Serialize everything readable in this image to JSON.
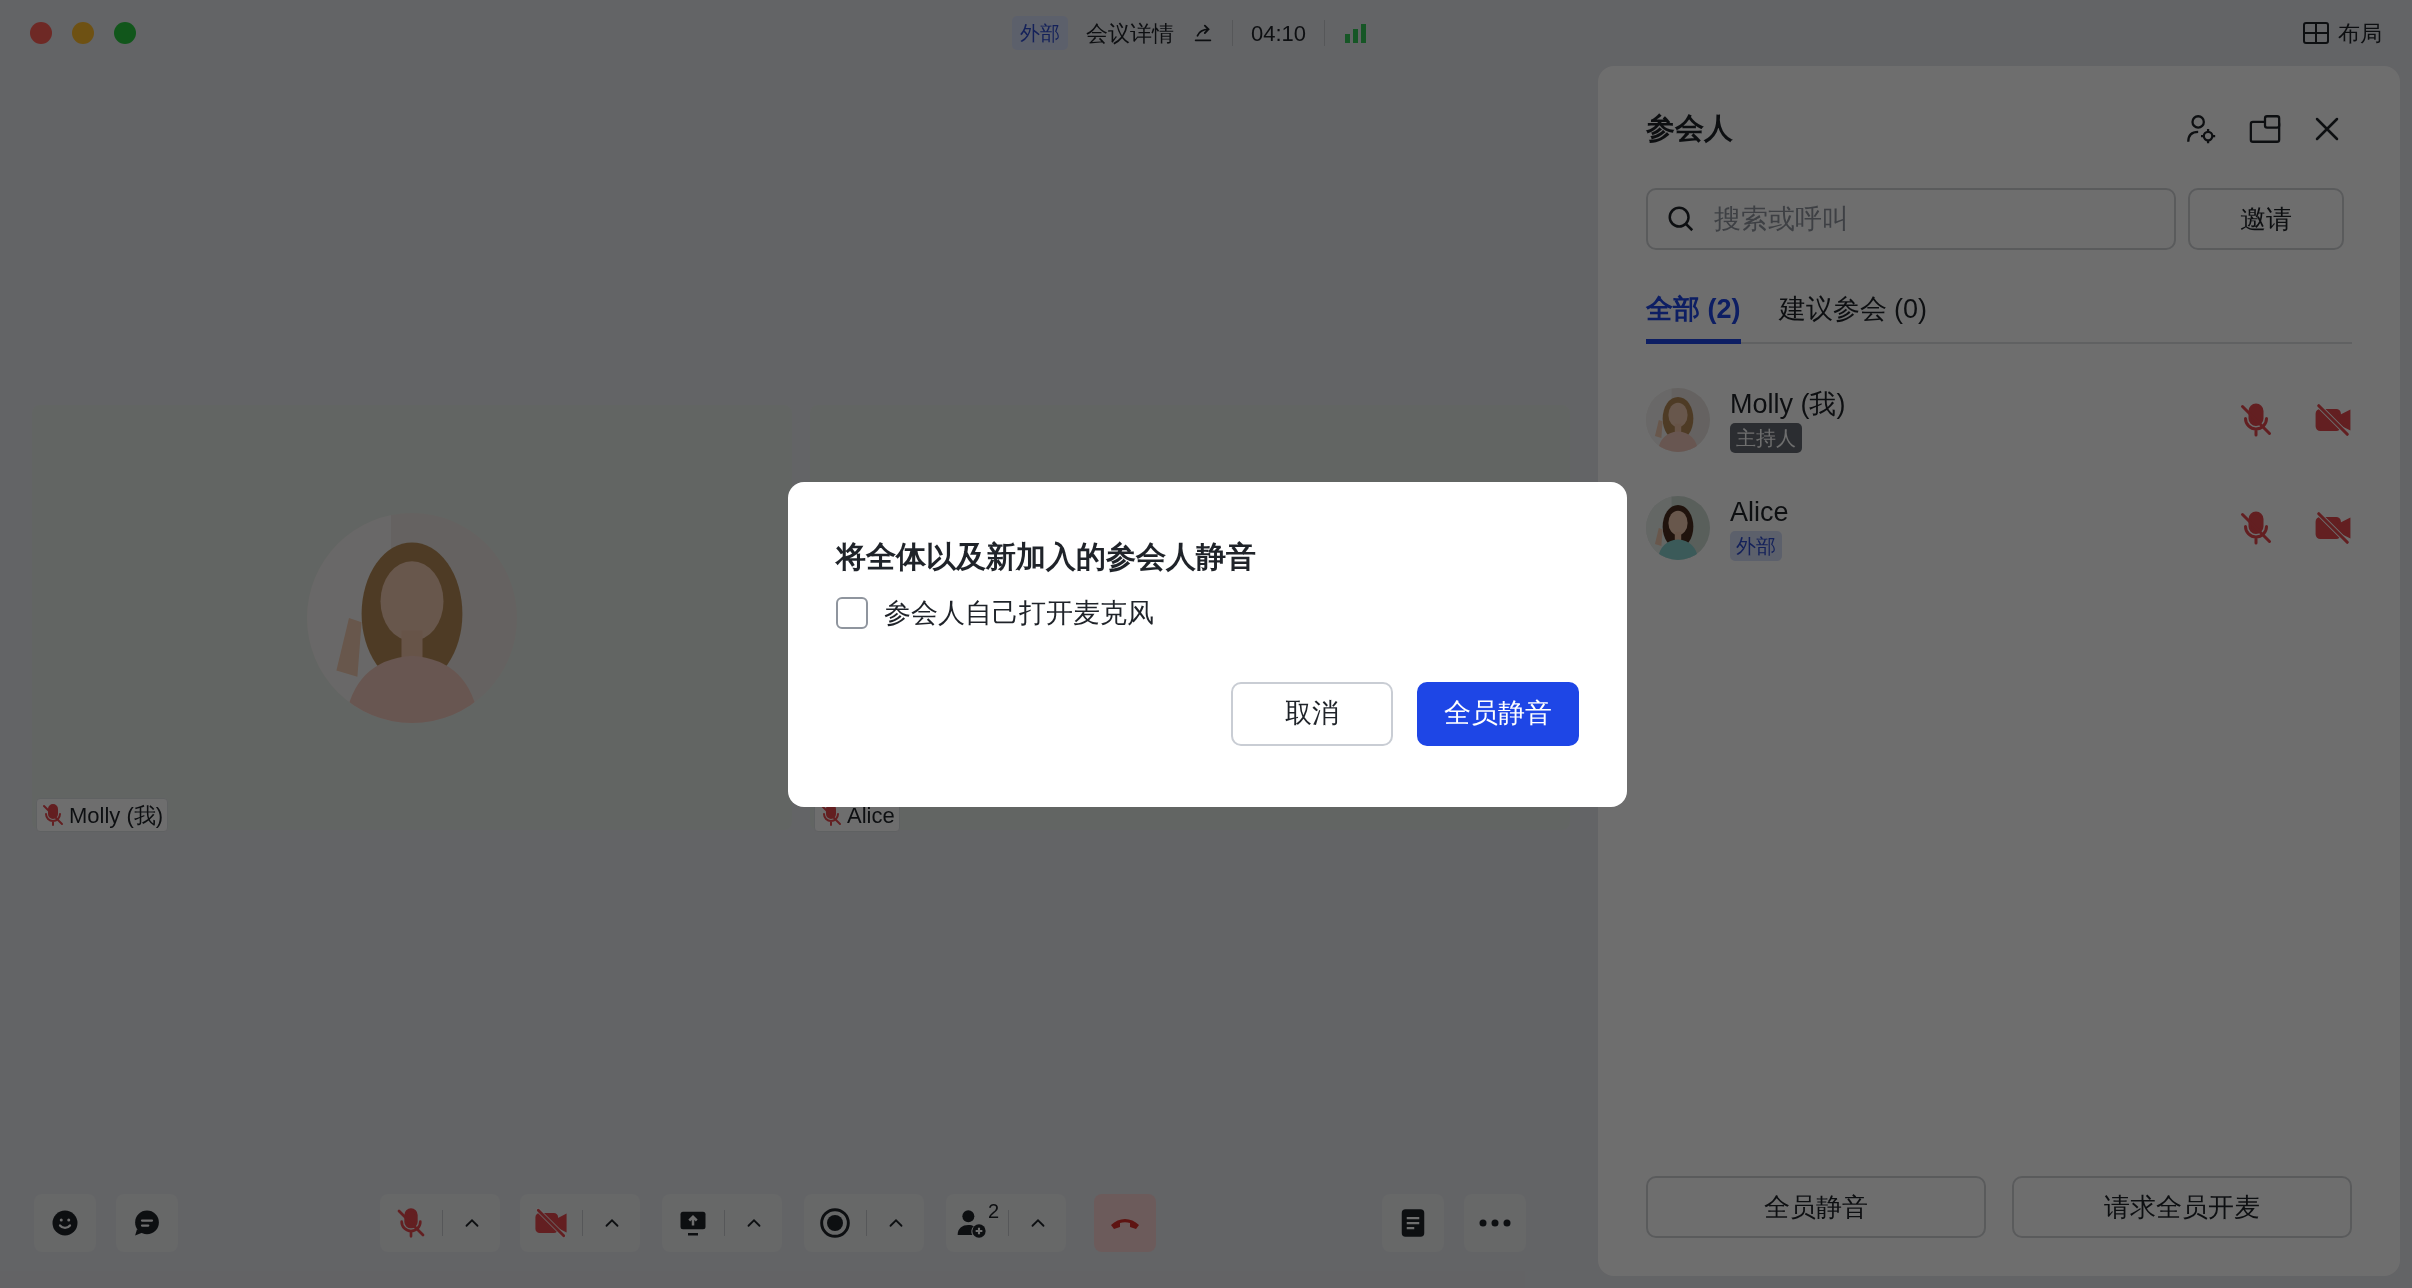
{
  "window": {
    "badge": "外部",
    "title": "会议详情",
    "timer": "04:10",
    "layout_button": "布局"
  },
  "stage": {
    "tiles": [
      {
        "name": "Molly (我)",
        "muted": true
      },
      {
        "name": "Alice",
        "muted": true
      }
    ]
  },
  "toolbar": {
    "mic_on": false,
    "camera_on": false,
    "participant_count": "2"
  },
  "panel": {
    "title": "参会人",
    "search": {
      "placeholder": "搜索或呼叫"
    },
    "invite_button": "邀请",
    "tabs": [
      {
        "label": "全部 (2)",
        "selected": true
      },
      {
        "label": "建议参会 (0)",
        "selected": false
      }
    ],
    "participants": [
      {
        "name": "Molly (我)",
        "badge": "主持人",
        "kind": "host",
        "mic_on": false,
        "camera_on": false
      },
      {
        "name": "Alice",
        "badge": "外部",
        "kind": "external",
        "mic_on": false,
        "camera_on": false
      }
    ],
    "footer_buttons": [
      "全员静音",
      "请求全员开麦"
    ]
  },
  "dialog": {
    "title": "将全体以及新加入的参会人静音",
    "checkbox": {
      "label": "参会人自己打开麦克风",
      "checked": false
    },
    "buttons": [
      {
        "label": "取消",
        "kind": "secondary"
      },
      {
        "label": "全员静音",
        "kind": "primary"
      }
    ]
  }
}
